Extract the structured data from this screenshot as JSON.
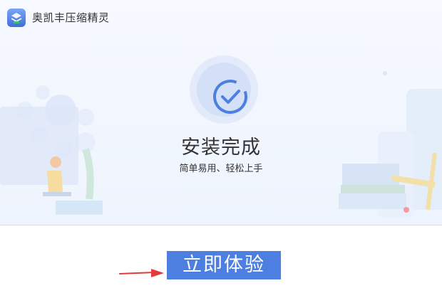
{
  "app": {
    "title": "奥凯丰压缩精灵"
  },
  "status": {
    "heading": "安装完成",
    "subheading": "简单易用、轻松上手"
  },
  "actions": {
    "primary_label": "立即体验"
  },
  "icons": {
    "app": "app-logo-icon",
    "status": "check-circle-icon",
    "pointer": "red-arrow-icon"
  },
  "colors": {
    "accent": "#4d7fe0",
    "check": "#4d7fe0",
    "arrow": "#e23b3b",
    "panel_bg": "#eef4fd"
  }
}
